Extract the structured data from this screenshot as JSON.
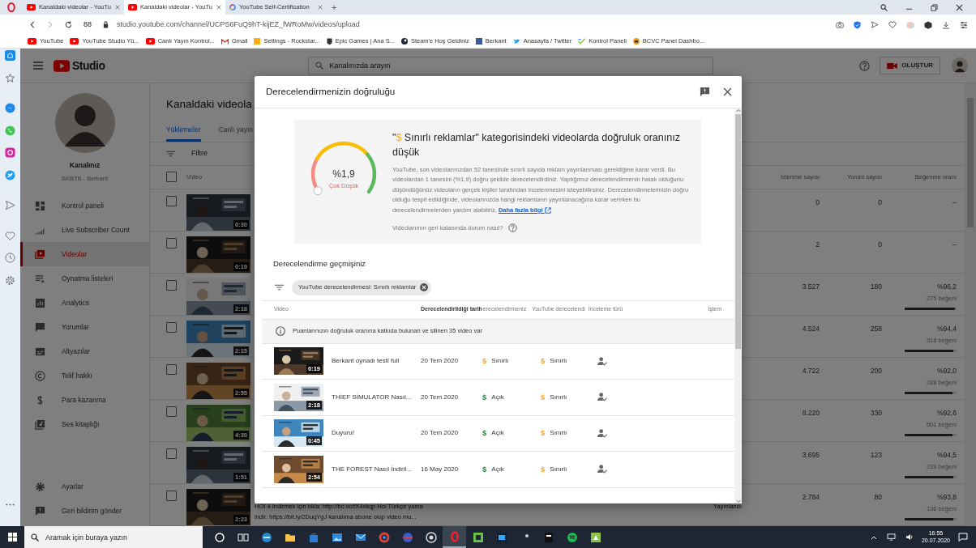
{
  "browser": {
    "tabs": [
      {
        "title": "Kanaldaki videolar - YouTu",
        "selected": false
      },
      {
        "title": "Kanaldaki videolar - YouTu",
        "selected": true
      },
      {
        "title": "YouTube Self-Certification",
        "selected": false
      }
    ],
    "new_tab": "+",
    "speed_dial": "88",
    "url": "studio.youtube.com/channel/UCPS6FuQ9hT-kijEZ_fWRoMw/videos/upload",
    "bookmarks": [
      "YouTube",
      "YouTube Studio Yü...",
      "Canlı Yayın Kontrol...",
      "Gmail",
      "Settings - Rockstar...",
      "Epic Games | Ana S...",
      "Steam'e Hoş Geldiniz",
      "Berkant",
      "Anasayfa / Twitter",
      "Kontrol Paneli",
      "BCVC Panel Dashbo..."
    ]
  },
  "studio": {
    "logo": "Studio",
    "search": {
      "placeholder": "Kanalınızda arayın"
    },
    "create_button": "OLUŞTUR",
    "channel": {
      "title": "Kanalınız",
      "subtitle": "BKBTB - Berkant"
    },
    "nav": [
      {
        "label": "Kontrol paneli",
        "selected": false
      },
      {
        "label": "Live Subscriber Count",
        "selected": false
      },
      {
        "label": "Videolar",
        "selected": true
      },
      {
        "label": "Oynatma listeleri",
        "selected": false
      },
      {
        "label": "Analytics",
        "selected": false
      },
      {
        "label": "Yorumlar",
        "selected": false
      },
      {
        "label": "Altyazılar",
        "selected": false
      },
      {
        "label": "Telif hakkı",
        "selected": false
      },
      {
        "label": "Para kazanma",
        "selected": false
      },
      {
        "label": "Ses kitaplığı",
        "selected": false
      }
    ],
    "nav_bottom": [
      "Ayarlar",
      "Geri bildirim gönder"
    ],
    "page_title": "Kanaldaki videola",
    "tabs": [
      {
        "label": "Yüklemeler",
        "selected": true
      },
      {
        "label": "Canlı yayın",
        "selected": false
      }
    ],
    "filter": {
      "placeholder": "Filtre"
    },
    "select_all_checked": false,
    "columns": [
      "Video",
      "İzlenme sayısı",
      "Yorum sayısı",
      "Beğenme oranı"
    ],
    "rows": [
      {
        "checked": false,
        "duration": "0:30",
        "views": "0",
        "comments": "0",
        "like_rate": "–"
      },
      {
        "checked": false,
        "duration": "0:19",
        "views": "2",
        "comments": "0",
        "like_rate": "–"
      },
      {
        "checked": false,
        "duration": "2:18",
        "views": "3.527",
        "comments": "180",
        "like_rate": "%96,2",
        "likes": "275 beğeni",
        "level": 0.962
      },
      {
        "checked": false,
        "duration": "2:15",
        "views": "4.524",
        "comments": "258",
        "like_rate": "%94,4",
        "likes": "318 beğeni",
        "level": 0.944
      },
      {
        "checked": false,
        "duration": "2:55",
        "views": "4.722",
        "comments": "200",
        "like_rate": "%92,0",
        "likes": "288 beğeni",
        "level": 0.92
      },
      {
        "checked": false,
        "duration": "4:30",
        "views": "8.220",
        "comments": "330",
        "like_rate": "%92,6",
        "likes": "501 beğeni",
        "level": 0.926
      },
      {
        "checked": false,
        "duration": "1:51",
        "views": "3.695",
        "comments": "123",
        "like_rate": "%94,5",
        "likes": "239 beğeni",
        "level": 0.945
      },
      {
        "checked": false,
        "duration": "2:23",
        "views": "2.784",
        "comments": "80",
        "like_rate": "%93,8",
        "likes": "136 beğeni",
        "level": 0.938,
        "description": [
          "HOI 4 İndirmek için tıkla: http://bc.vc/tX4xkqp Hoi Türkçe yama",
          "indir: https://bit.ly/2DuqYgJ kanalıma abone olup video mu..."
        ],
        "status": "Yayınlandı"
      }
    ]
  },
  "modal": {
    "title": "Derecelendirmenizin doğruluğu",
    "summary": {
      "score": "%1,9",
      "score_label": "Çok Düşük",
      "heading_quote": "\"",
      "heading_icon": "$",
      "heading": "Sınırlı reklamlar\" kategorisindeki videolarda doğruluk oranınız düşük",
      "body": "YouTube, son videolarınızdan 52 tanesinde sınırlı sayıda reklam yayınlanması gerektiğine karar verdi. Bu videolardan 1 tanesini (%1,9) doğru şekilde derecelendirdiniz. Yaptığımız derecelendirmenin hatalı olduğunu düşündüğünüz videoların gerçek kişiler tarafından incelenmesini isteyebilirsiniz. Derecelendirmelerinizin doğru olduğu tespit edildiğinde, videolarınızda hangi reklamların yayınlanacağına karar verirken bu derecelendirmelerden yardım alabiliriz.",
      "link": "Daha fazla bilgi",
      "question": "Videolarımın geri kalanında durum nasıl?"
    },
    "history_title": "Derecelendirme geçmişiniz",
    "chip": "YouTube derecelendirmesi: Sınırlı reklamlar",
    "columns": [
      "Video",
      "Derecelendirildiği tarih",
      "erecelendirmeniz",
      "YouTube derecelendi",
      "İnceleme türü",
      "İşlem"
    ],
    "notice": "Puanlarınızın doğruluk oranına katkıda bulunan ve silinen 35 video var",
    "rows": [
      {
        "title": "Berkant oynadı testi full",
        "duration": "0:19",
        "date": "20 Tem 2020",
        "yours": {
          "kind": "limited",
          "icon": "$",
          "label": "Sınırlı"
        },
        "youtube": {
          "kind": "limited",
          "icon": "$",
          "label": "Sınırlı"
        }
      },
      {
        "title": "THİEF SİMULATOR Nasıl...",
        "duration": "2:18",
        "date": "20 Tem 2020",
        "yours": {
          "kind": "on",
          "icon": "$",
          "label": "Açık"
        },
        "youtube": {
          "kind": "limited",
          "icon": "$",
          "label": "Sınırlı"
        }
      },
      {
        "title": "Duyuru!",
        "duration": "0:45",
        "date": "20 Tem 2020",
        "yours": {
          "kind": "on",
          "icon": "$",
          "label": "Açık"
        },
        "youtube": {
          "kind": "limited",
          "icon": "$",
          "label": "Sınırlı"
        }
      },
      {
        "title": "THE FOREST Nasıl İndiril...",
        "duration": "2:54",
        "date": "16 May 2020",
        "yours": {
          "kind": "on",
          "icon": "$",
          "label": "Açık"
        },
        "youtube": {
          "kind": "limited",
          "icon": "$",
          "label": "Sınırlı"
        }
      }
    ]
  },
  "taskbar": {
    "search": {
      "placeholder": "Aramak için buraya yazın"
    },
    "time": "16:55",
    "date": "20.07.2020"
  }
}
